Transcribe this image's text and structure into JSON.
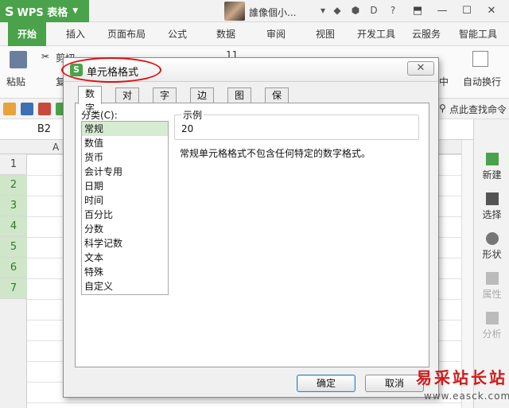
{
  "app": {
    "name": "WPS 表格",
    "user": "誰像個小..."
  },
  "ribbon_tabs": [
    "开始",
    "插入",
    "页面布局",
    "公式",
    "数据",
    "审阅",
    "视图",
    "开发工具",
    "云服务",
    "智能工具"
  ],
  "ribbon": {
    "cut": "剪切",
    "copy": "复",
    "paste": "粘贴",
    "font_size": "11",
    "center": "中",
    "auto_wrap": "自动换行"
  },
  "quickbar": {
    "find_cmd": "点此查找命令"
  },
  "formula": {
    "cell_ref": "B2"
  },
  "grid": {
    "col_a": "A",
    "rows": [
      "1",
      "2",
      "3",
      "4",
      "5",
      "6",
      "7"
    ]
  },
  "side_panel": {
    "new": "新建",
    "select": "选择",
    "shape": "形状",
    "property": "属性",
    "analyze": "分析"
  },
  "dialog": {
    "title": "单元格格式",
    "tabs": [
      "数字",
      "对齐",
      "字体",
      "边框",
      "图案",
      "保护"
    ],
    "category_label": "分类(C):",
    "categories": [
      "常规",
      "数值",
      "货币",
      "会计专用",
      "日期",
      "时间",
      "百分比",
      "分数",
      "科学记数",
      "文本",
      "特殊",
      "自定义"
    ],
    "sample_label": "示例",
    "sample_value": "20",
    "description": "常规单元格格式不包含任何特定的数字格式。",
    "ok": "确定",
    "cancel": "取消"
  },
  "watermark": {
    "text": "易采站长站",
    "url": "www.easck.com"
  }
}
